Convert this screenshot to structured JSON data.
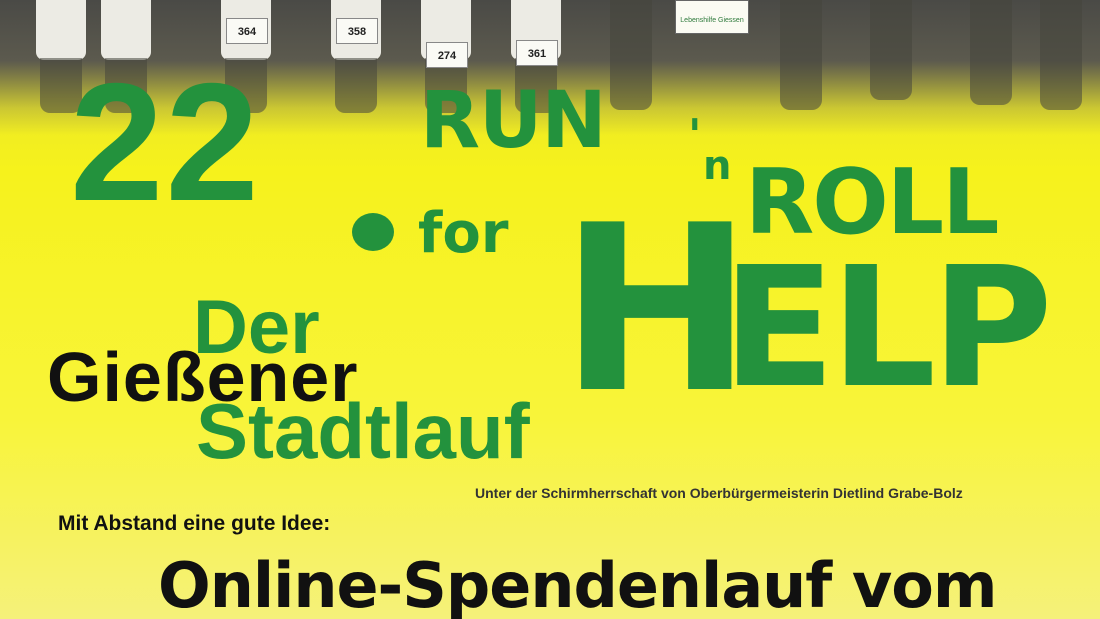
{
  "photo": {
    "bibs": [
      "364",
      "358",
      "274",
      "361"
    ],
    "sign_text": "Lebenshilfe Giessen"
  },
  "title": {
    "edition": "22",
    "run": "RUN",
    "apostrophe": "'",
    "n": "n",
    "roll": "ROLL",
    "for": "for",
    "help_h": "H",
    "help_rest": "ELP"
  },
  "event": {
    "der": "Der",
    "city": "Gießener",
    "stadtlauf": "Stadtlauf"
  },
  "patronage": "Unter der Schirmherrschaft von Oberbürgermeisterin Dietlind Grabe-Bolz",
  "subheadline": "Mit Abstand eine gute Idee:",
  "headline": "Online-Spendenlauf vom",
  "colors": {
    "brand_green": "#23923d",
    "background_yellow": "#f6f21c",
    "text_black": "#111111"
  }
}
